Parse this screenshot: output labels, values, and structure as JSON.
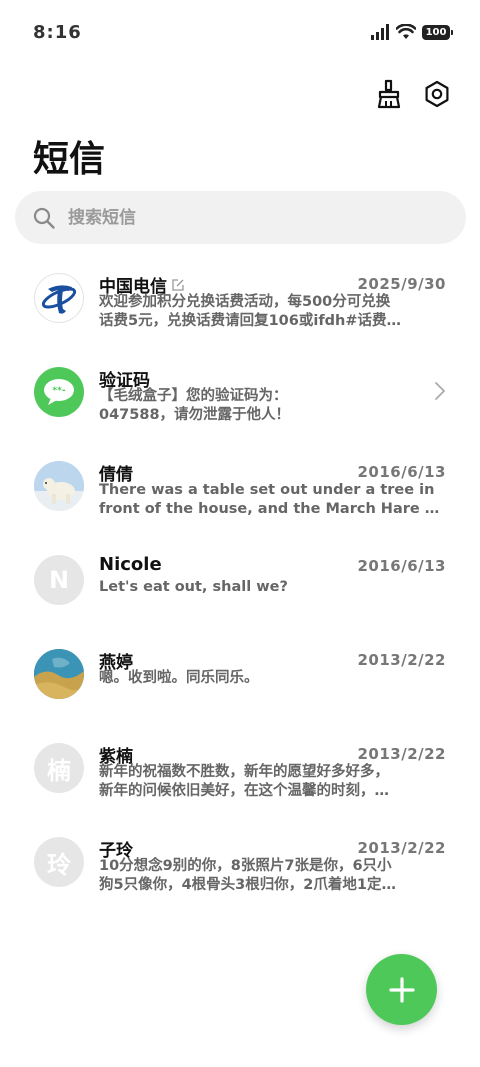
{
  "status": {
    "time": "8:16",
    "battery": "100"
  },
  "header": {
    "title": "短信",
    "clean_icon": "broom-icon",
    "settings_icon": "gear-icon"
  },
  "search": {
    "placeholder": "搜索短信",
    "icon": "search-icon"
  },
  "conversations": [
    {
      "name": "中国电信",
      "date": "2025/9/30",
      "line1": "欢迎参加积分兑换话费活动，每500分可兑换",
      "line2": "话费5元，兑换话费请回复106或ifdh#话费…",
      "avatar": "china-telecom-logo",
      "edited_icon": "edit-icon"
    },
    {
      "name": "验证码",
      "date": "",
      "line1": "【毛绒盒子】您的验证码为：",
      "line2": "047588，请勿泄露于他人！",
      "avatar": "message-bubble-icon",
      "chevron": "chevron-right-icon"
    },
    {
      "name": "倩倩",
      "date": "2016/6/13",
      "line1": "There was a table set out under a tree in",
      "line2": "front of the house, and the March Hare …",
      "avatar": "polar-bear-photo"
    },
    {
      "name": "Nicole",
      "date": "2016/6/13",
      "line1": "Let's eat out, shall we?",
      "line2": "",
      "avatar_letter": "N"
    },
    {
      "name": "燕婷",
      "date": "2013/2/22",
      "line1": "嗯。收到啦。同乐同乐。",
      "line2": "",
      "avatar": "landscape-photo"
    },
    {
      "name": "紫楠",
      "date": "2013/2/22",
      "line1": "新年的祝福数不胜数，新年的愿望好多好多，",
      "line2": "新年的问候依旧美好，在这个温馨的时刻，…",
      "avatar_letter": "楠"
    },
    {
      "name": "子玲",
      "date": "2013/2/22",
      "line1": "10分想念9别的你，8张照片7张是你，6只小",
      "line2": "狗5只像你，4根骨头3根归你，2爪着地1定…",
      "avatar_letter": "玲"
    }
  ],
  "fab": {
    "icon": "plus-icon"
  },
  "colors": {
    "accent": "#4fc85a",
    "telecom_blue": "#1a4fa0"
  }
}
